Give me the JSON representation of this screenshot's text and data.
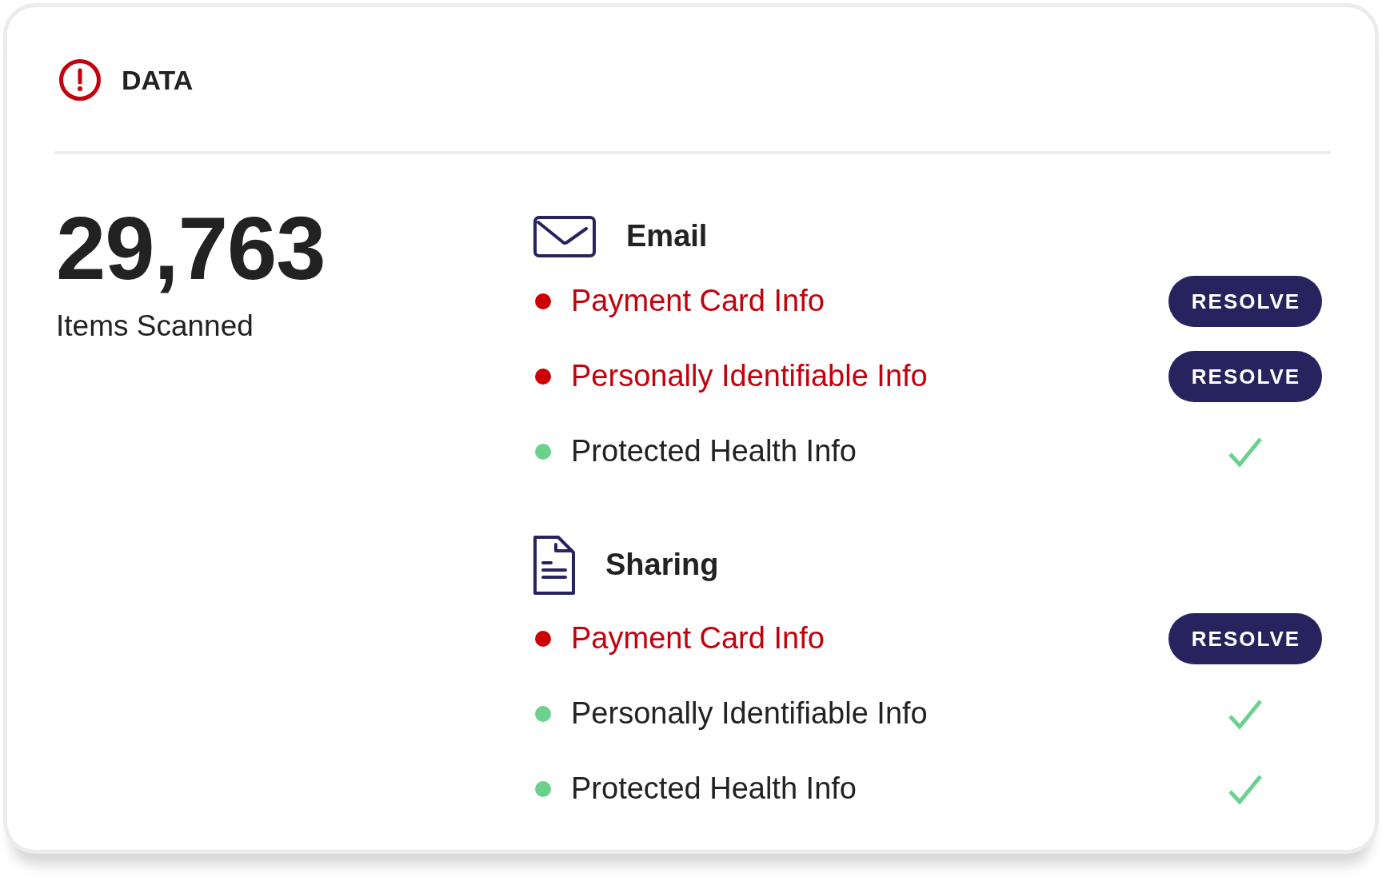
{
  "header": {
    "title": "DATA"
  },
  "summary": {
    "count": "29,763",
    "label": "Items Scanned"
  },
  "sections": [
    {
      "kind": "email",
      "title": "Email",
      "items": [
        {
          "label": "Payment Card Info",
          "flagged": true,
          "action": "RESOLVE"
        },
        {
          "label": "Personally Identifiable Info",
          "flagged": true,
          "action": "RESOLVE"
        },
        {
          "label": "Protected Health Info",
          "flagged": false
        }
      ]
    },
    {
      "kind": "document",
      "title": "Sharing",
      "items": [
        {
          "label": "Payment Card Info",
          "flagged": true,
          "action": "RESOLVE"
        },
        {
          "label": "Personally Identifiable Info",
          "flagged": false
        },
        {
          "label": "Protected Health Info",
          "flagged": false
        }
      ]
    }
  ]
}
